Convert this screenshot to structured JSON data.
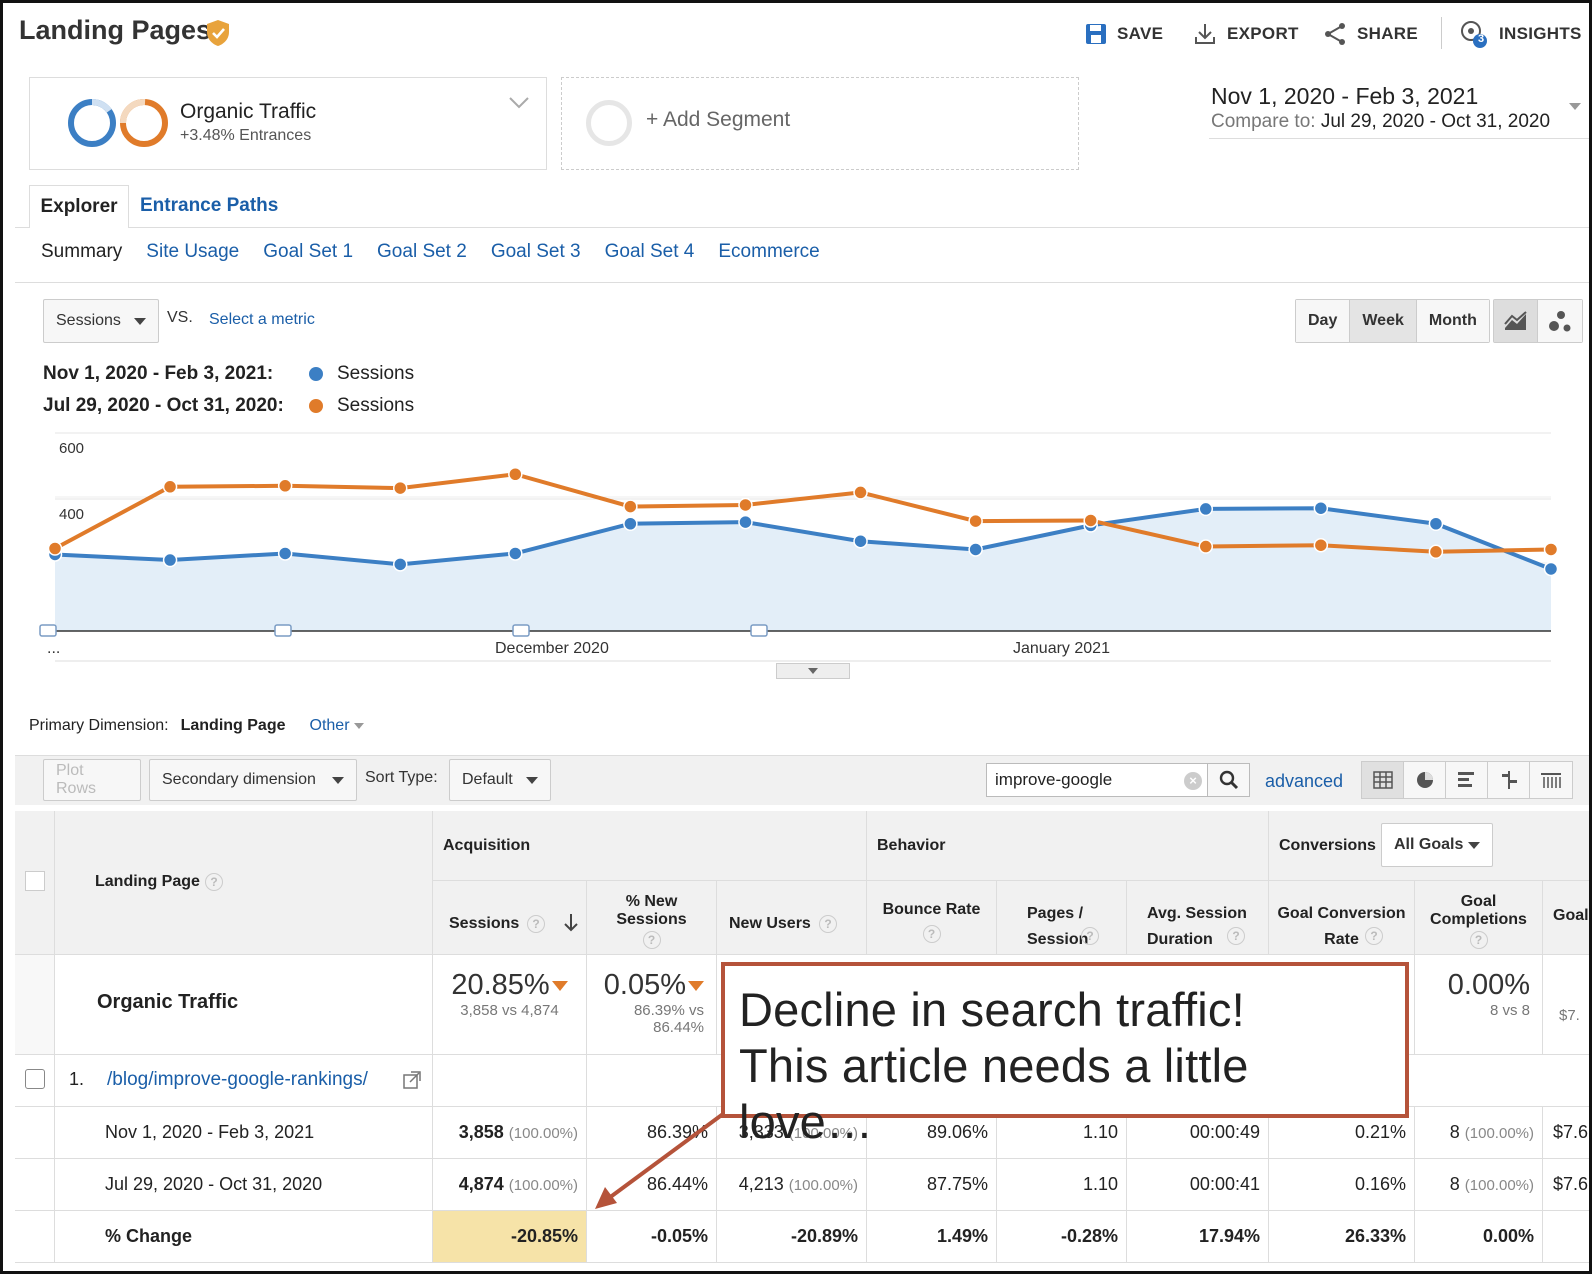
{
  "header": {
    "title": "Landing Pages",
    "save": "SAVE",
    "export": "EXPORT",
    "share": "SHARE",
    "insights": "INSIGHTS",
    "insights_badge": "3",
    "accent": "#1a73e8"
  },
  "segments": {
    "active": {
      "name": "Organic Traffic",
      "sub": "+3.48% Entrances"
    },
    "add_label": "+ Add Segment"
  },
  "dates": {
    "range": "Nov 1, 2020 - Feb 3, 2021",
    "compare_label": "Compare to:",
    "compare_range": "Jul 29, 2020 - Oct 31, 2020"
  },
  "tabs": [
    "Explorer",
    "Entrance Paths"
  ],
  "sub_tabs": [
    "Summary",
    "Site Usage",
    "Goal Set 1",
    "Goal Set 2",
    "Goal Set 3",
    "Goal Set 4",
    "Ecommerce"
  ],
  "metric": {
    "selected": "Sessions",
    "vs": "VS.",
    "select_metric": "Select a metric"
  },
  "period": [
    "Day",
    "Week",
    "Month"
  ],
  "period_active": "Week",
  "legend": [
    {
      "range": "Nov 1, 2020 - Feb 3, 2021:",
      "label": "Sessions",
      "color": "#3c7fc4"
    },
    {
      "range": "Jul 29, 2020 - Oct 31, 2020:",
      "label": "Sessions",
      "color": "#e07b2a"
    }
  ],
  "chart_data": {
    "type": "line",
    "x": [
      "Nov 1",
      "Nov 8",
      "Nov 15",
      "Nov 22",
      "Nov 29",
      "Dec 6",
      "Dec 13",
      "Dec 20",
      "Dec 27",
      "Jan 3",
      "Jan 10",
      "Jan 17",
      "Jan 24",
      "Jan 31"
    ],
    "x_tick_labels": [
      "...",
      "December 2020",
      "January 2021"
    ],
    "ylim": [
      0,
      600
    ],
    "y_ticks": [
      200,
      400,
      600
    ],
    "series": [
      {
        "name": "Sessions",
        "color": "#3c7fc4",
        "area": true,
        "values": [
          232,
          215,
          235,
          202,
          235,
          325,
          330,
          272,
          247,
          320,
          370,
          372,
          325,
          188
        ]
      },
      {
        "name": "Sessions",
        "color": "#e07b2a",
        "area": false,
        "values": [
          250,
          437,
          440,
          433,
          475,
          377,
          382,
          420,
          333,
          335,
          256,
          260,
          240,
          247
        ]
      }
    ]
  },
  "dimension": {
    "label": "Primary Dimension:",
    "value": "Landing Page",
    "other": "Other"
  },
  "toolbar": {
    "plot_rows": "Plot Rows",
    "secondary": "Secondary dimension",
    "sort_label": "Sort Type:",
    "sort_value": "Default",
    "search": "improve-google",
    "advanced": "advanced"
  },
  "table": {
    "groups": {
      "acquisition": "Acquisition",
      "behavior": "Behavior",
      "conversions": "Conversions",
      "goals_select": "All Goals"
    },
    "columns": {
      "landing": "Landing Page",
      "sessions": "Sessions",
      "new_sessions": "% New Sessions",
      "new_users": "New Users",
      "bounce": "Bounce Rate",
      "pages": "Pages / Session",
      "duration": "Avg. Session Duration",
      "goal_rate": "Goal Conversion Rate",
      "goal_comp": "Goal Completions",
      "goal_value": "Goal"
    },
    "summary": {
      "label": "Organic Traffic",
      "sessions": "20.85%",
      "sessions_sub": "3,858 vs 4,874",
      "new_sessions": "0.05%",
      "new_sessions_sub1": "86.39% vs",
      "new_sessions_sub2": "86.44%",
      "goal_comp": "0.00%",
      "goal_comp_sub": "8 vs 8",
      "goal_value_sub": "$7."
    },
    "row_index": "1.",
    "row_page": "/blog/improve-google-rankings/",
    "rows": [
      {
        "label": "Nov 1, 2020 - Feb 3, 2021",
        "sessions": "3,858",
        "sessions_pct": "(100.00%)",
        "new_sessions": "86.39%",
        "new_users": "3,333",
        "new_users_pct": "(100.00%)",
        "bounce": "89.06%",
        "pages": "1.10",
        "duration": "00:00:49",
        "goal_rate": "0.21%",
        "goal_comp": "8",
        "goal_comp_pct": "(100.00%)",
        "goal_value": "$7.6"
      },
      {
        "label": "Jul 29, 2020 - Oct 31, 2020",
        "sessions": "4,874",
        "sessions_pct": "(100.00%)",
        "new_sessions": "86.44%",
        "new_users": "4,213",
        "new_users_pct": "(100.00%)",
        "bounce": "87.75%",
        "pages": "1.10",
        "duration": "00:00:41",
        "goal_rate": "0.16%",
        "goal_comp": "8",
        "goal_comp_pct": "(100.00%)",
        "goal_value": "$7.6"
      },
      {
        "label": "% Change",
        "sessions": "-20.85%",
        "new_sessions": "-0.05%",
        "new_users": "-20.89%",
        "bounce": "1.49%",
        "pages": "-0.28%",
        "duration": "17.94%",
        "goal_rate": "26.33%",
        "goal_comp": "0.00%"
      }
    ]
  },
  "callout": {
    "line1": "Decline in search traffic!",
    "line2": "This article needs a little love…",
    "border_color": "#b5533a"
  }
}
